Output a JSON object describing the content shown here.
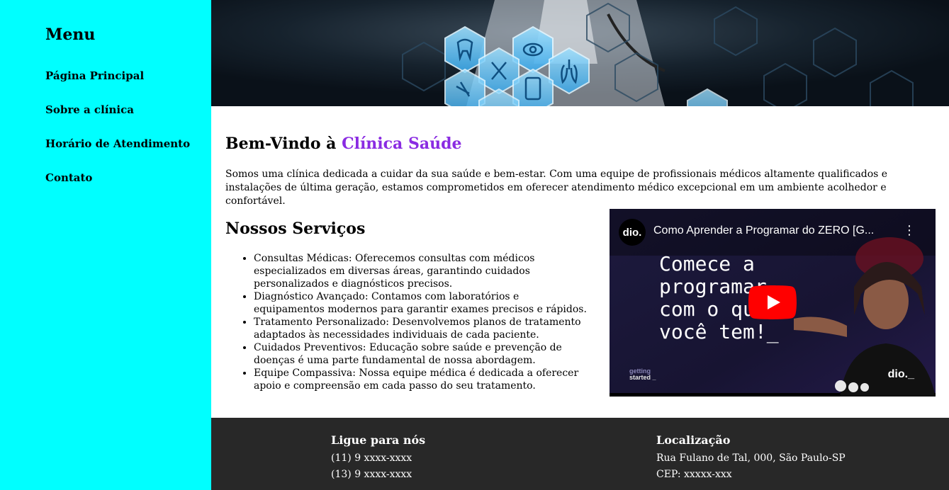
{
  "sidebar": {
    "title": "Menu",
    "items": [
      {
        "label": "Página Principal"
      },
      {
        "label": "Sobre a clínica"
      },
      {
        "label": "Horário de Atendimento"
      },
      {
        "label": "Contato"
      }
    ]
  },
  "hero": {
    "image": "medical-hexagon-icons-banner",
    "icons": [
      "tooth-icon",
      "eye-icon",
      "dna-icon",
      "lungs-icon",
      "pill-icon",
      "phone-icon",
      "heartbeat-icon"
    ]
  },
  "welcome": {
    "prefix": "Bem-Vindo à ",
    "clinic_name": "Clínica Saúde",
    "accent_color": "#8a2be2"
  },
  "intro": "Somos uma clínica dedicada a cuidar da sua saúde e bem-estar. Com uma equipe de profissionais médicos altamente qualificados e instalações de última geração, estamos comprometidos em oferecer atendimento médico excepcional em um ambiente acolhedor e confortável.",
  "services": {
    "title": "Nossos Serviços",
    "items": [
      "Consultas Médicas: Oferecemos consultas com médicos especializados em diversas áreas, garantindo cuidados personalizados e diagnósticos precisos.",
      "Diagnóstico Avançado: Contamos com laboratórios e equipamentos modernos para garantir exames precisos e rápidos.",
      "Tratamento Personalizado: Desenvolvemos planos de tratamento adaptados às necessidades individuais de cada paciente.",
      "Cuidados Preventivos: Educação sobre saúde e prevenção de doenças é uma parte fundamental de nossa abordagem.",
      "Equipe Compassiva: Nossa equipe médica é dedicada a oferecer apoio e compreensão em cada passo do seu tratamento."
    ]
  },
  "video": {
    "title": "Como Aprender a Programar do ZERO [G...",
    "channel_logo": "dio.",
    "headline": "Comece a\nprogramar\ncom o que\nvocê tem!_",
    "tag_line1": "getting",
    "tag_line2": "started _",
    "brand": "dio._",
    "menu_icon": "more-vert-icon",
    "play_icon": "youtube-play-icon",
    "play_color": "#ff0000"
  },
  "footer": {
    "contact": {
      "title": "Ligue para nós",
      "lines": [
        "(11) 9 xxxx-xxxx",
        "(13) 9 xxxx-xxxx"
      ]
    },
    "location": {
      "title": "Localização",
      "lines": [
        "Rua Fulano de Tal, 000, São Paulo-SP",
        "CEP: xxxxx-xxx"
      ]
    }
  },
  "colors": {
    "sidebar_bg": "#00ffff",
    "footer_bg": "#282828",
    "hero_bg": "#0b131b"
  }
}
